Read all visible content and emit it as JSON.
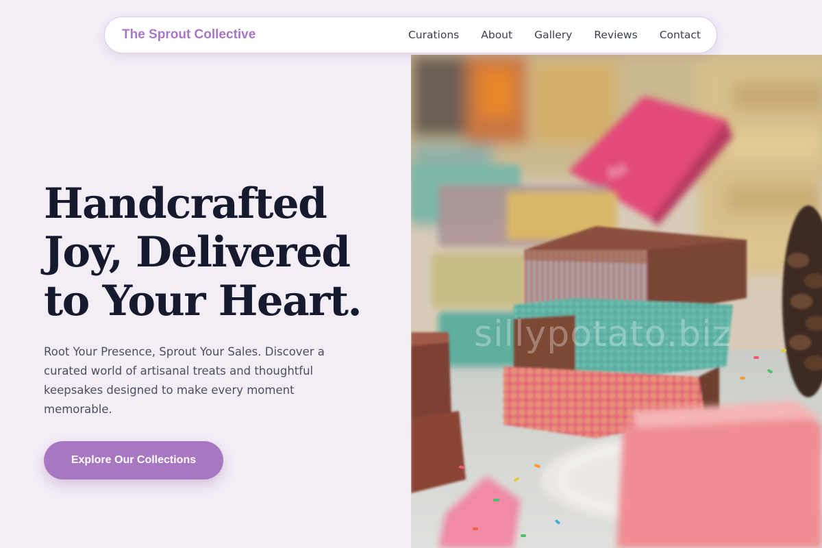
{
  "navbar": {
    "brand": "The Sprout Collective",
    "links": [
      "Curations",
      "About",
      "Gallery",
      "Reviews",
      "Contact"
    ]
  },
  "hero": {
    "title_lines": [
      "Handcrafted",
      "Joy, Delivered",
      "to Your Heart."
    ],
    "subtitle": "Root Your Presence, Sprout Your Sales. Discover a curated world of artisanal treats and thoughtful keepsakes designed to make every moment memorable.",
    "cta_label": "Explore Our Collections"
  },
  "image": {
    "watermark": "sillypotato.biz"
  },
  "colors": {
    "background": "#f3edf6",
    "accent": "#a877c2",
    "heading": "#161a2e",
    "body_text": "#4b5060"
  }
}
